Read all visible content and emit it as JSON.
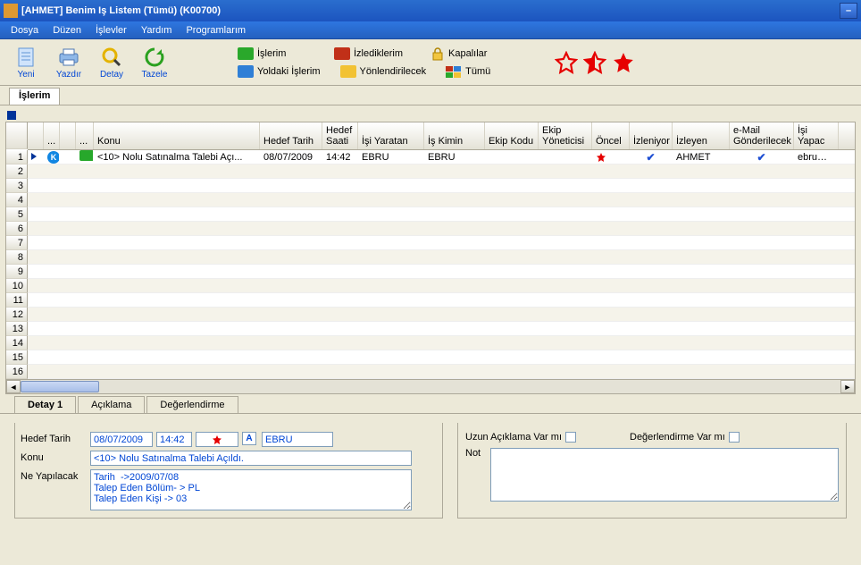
{
  "window": {
    "title": "[AHMET] Benim Iş Listem (Tümü) (K00700)"
  },
  "menu": {
    "items": [
      "Dosya",
      "Düzen",
      "İşlevler",
      "Yardım",
      "Programlarım"
    ]
  },
  "toolbar": {
    "yeni": "Yeni",
    "yazdir": "Yazdır",
    "detay": "Detay",
    "tazele": "Tazele"
  },
  "folders": {
    "islerim": "İşlerim",
    "izlediklerim": "İzlediklerim",
    "kapalilar": "Kapalılar",
    "yoldaki": "Yoldaki İşlerim",
    "yonlendirilecek": "Yönlendirilecek",
    "tumu": "Tümü"
  },
  "mainTabs": {
    "islerim": "İşlerim"
  },
  "grid": {
    "headers": {
      "dots": "...",
      "blank": "...",
      "konu": "Konu",
      "hedef_tarih": "Hedef Tarih",
      "hedef_saati": "Hedef Saati",
      "isi_yaratan": "İşi Yaratan",
      "is_kimin": "İş Kimin",
      "ekip_kodu": "Ekip Kodu",
      "ekip_yon": "Ekip Yöneticisi",
      "oncel": "Öncel",
      "izleniyor": "İzleniyor",
      "izleyen": "İzleyen",
      "email": "e-Mail Gönderilecek",
      "isi_yapac": "İşi Yapac"
    },
    "row1": {
      "konu": "<10> Nolu Satınalma Talebi Açı...",
      "hedef_tarih": "08/07/2009",
      "hedef_saati": "14:42",
      "isi_yaratan": "EBRU",
      "is_kimin": "EBRU",
      "ekip_kodu": "",
      "ekip_yon": "",
      "izleyen": "AHMET",
      "isi_yapac": "ebru@diy"
    },
    "rowcount": 16
  },
  "detailTabs": {
    "tab1": "Detay 1",
    "tab2": "Açıklama",
    "tab3": "Değerlendirme"
  },
  "detail": {
    "hedef_tarih_label": "Hedef Tarih",
    "hedef_tarih_val": "08/07/2009",
    "hedef_saat_val": "14:42",
    "ebru": "EBRU",
    "konu_label": "Konu",
    "konu_val": "<10> Nolu Satınalma Talebi Açıldı.",
    "neyap_label": "Ne Yapılacak",
    "neyap_val": "Tarih  ->2009/07/08\nTalep Eden Bölüm- > PL\nTalep Eden Kişi -> 03",
    "uzun_acik": "Uzun Açıklama Var mı",
    "degerlendirme": "Değerlendirme Var mı",
    "not": "Not"
  }
}
